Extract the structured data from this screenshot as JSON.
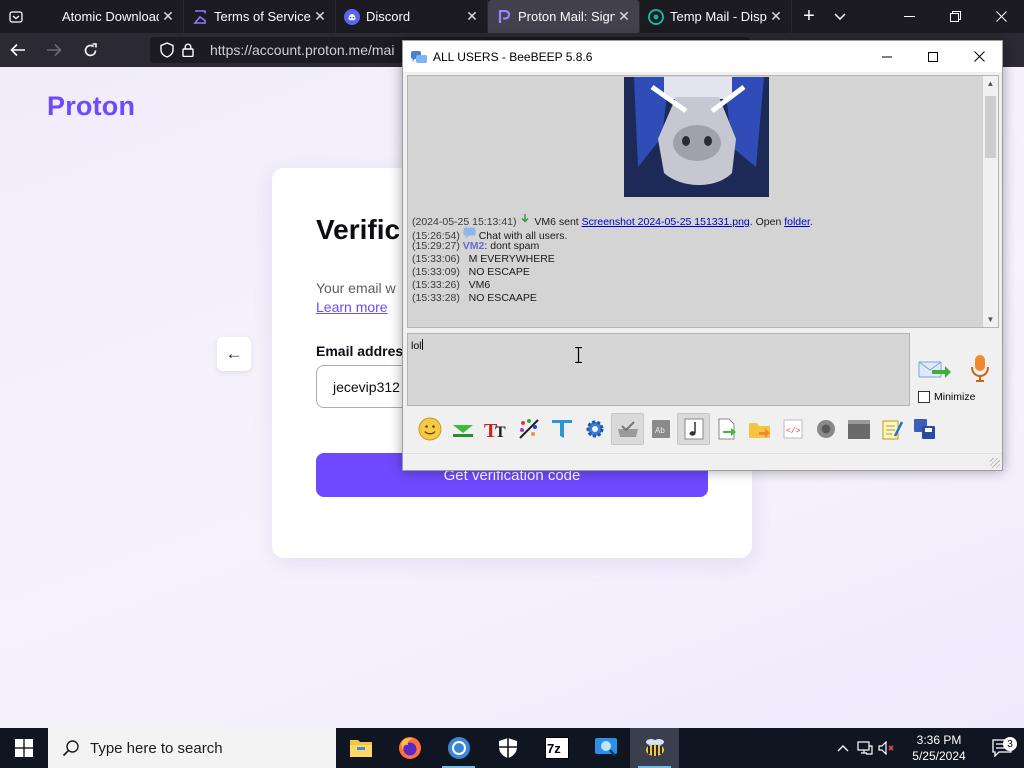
{
  "browser": {
    "tabs": [
      {
        "title": "Atomic Downloads",
        "icon": "page-icon",
        "active": false
      },
      {
        "title": "Terms of Service",
        "icon": "sigma-icon",
        "active": false
      },
      {
        "title": "Discord",
        "icon": "discord-icon",
        "active": false
      },
      {
        "title": "Proton Mail: Sign",
        "icon": "proton-icon",
        "active": true
      },
      {
        "title": "Temp Mail - Dispo",
        "icon": "tempmail-icon",
        "active": false
      }
    ],
    "close_glyph": "✕",
    "new_tab_glyph": "+",
    "url": "https://account.proton.me/mai"
  },
  "proton": {
    "logo": "Proton",
    "title": "Verific",
    "description": "Your email w",
    "learn_more": "Learn more",
    "email_label": "Email addres",
    "email_value": "jecevip312",
    "button": "Get verification code",
    "accent": "#6d4aff"
  },
  "beebeep": {
    "title": "ALL USERS - BeeBEEP 5.8.6",
    "messages": [
      {
        "ts": "(2024-05-25 15:13:41)",
        "pre": "VM6 sent",
        "link": "Screenshot 2024-05-25 151331.png",
        "mid": ". Open",
        "link2": "folder",
        "post": "."
      },
      {
        "ts": "(15:26:54)",
        "text": "Chat with all users."
      },
      {
        "ts": "(15:29:27)",
        "user": "VM2",
        "text": ": dont spam"
      },
      {
        "ts": "(15:33:06)",
        "text": "M EVERYWHERE"
      },
      {
        "ts": "(15:33:09)",
        "text": "NO ESCAPE"
      },
      {
        "ts": "(15:33:26)",
        "text": "VM6"
      },
      {
        "ts": "(15:33:28)",
        "text": "NO ESCAAPE"
      }
    ],
    "compose_text": "lol",
    "minimize_label": "Minimize",
    "minimize_checked": false
  },
  "taskbar": {
    "search_placeholder": "Type here to search",
    "time": "3:36 PM",
    "date": "5/25/2024",
    "notification_count": "3",
    "apps": [
      "file-explorer-icon",
      "firefox-icon",
      "chrome-icon",
      "security-icon",
      "7zip-icon",
      "network-app-icon",
      "beebeep-icon"
    ]
  }
}
